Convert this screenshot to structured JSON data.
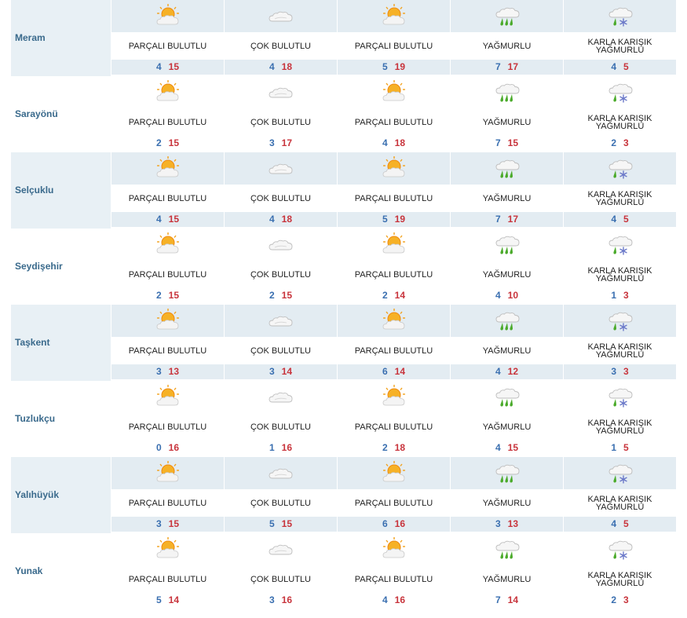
{
  "conditions": {
    "partly_cloudy": "PARÇALI BULUTLU",
    "very_cloudy": "ÇOK BULUTLU",
    "rainy": "YAĞMURLU",
    "sleet": "KARLA KARIŞIK YAĞMURLU"
  },
  "day_conditions": [
    "partly_cloudy",
    "very_cloudy",
    "partly_cloudy",
    "rainy",
    "sleet"
  ],
  "icons": {
    "partly_cloudy": "sun-cloud-icon",
    "very_cloudy": "cloud-icon",
    "rainy": "rain-icon",
    "sleet": "sleet-icon"
  },
  "colors": {
    "low": "#3a6fb0",
    "high": "#c8343c",
    "city": "#3a6a8c",
    "shade": "#e3ecf2"
  },
  "rows": [
    {
      "city": "Meram",
      "temps": [
        [
          4,
          15
        ],
        [
          4,
          18
        ],
        [
          5,
          19
        ],
        [
          7,
          17
        ],
        [
          4,
          5
        ]
      ]
    },
    {
      "city": "Sarayönü",
      "temps": [
        [
          2,
          15
        ],
        [
          3,
          17
        ],
        [
          4,
          18
        ],
        [
          7,
          15
        ],
        [
          2,
          3
        ]
      ]
    },
    {
      "city": "Selçuklu",
      "temps": [
        [
          4,
          15
        ],
        [
          4,
          18
        ],
        [
          5,
          19
        ],
        [
          7,
          17
        ],
        [
          4,
          5
        ]
      ]
    },
    {
      "city": "Seydişehir",
      "temps": [
        [
          2,
          15
        ],
        [
          2,
          15
        ],
        [
          2,
          14
        ],
        [
          4,
          10
        ],
        [
          1,
          3
        ]
      ]
    },
    {
      "city": "Taşkent",
      "temps": [
        [
          3,
          13
        ],
        [
          3,
          14
        ],
        [
          6,
          14
        ],
        [
          4,
          12
        ],
        [
          3,
          3
        ]
      ]
    },
    {
      "city": "Tuzlukçu",
      "temps": [
        [
          0,
          16
        ],
        [
          1,
          16
        ],
        [
          2,
          18
        ],
        [
          4,
          15
        ],
        [
          1,
          5
        ]
      ]
    },
    {
      "city": "Yalıhüyük",
      "temps": [
        [
          3,
          15
        ],
        [
          5,
          15
        ],
        [
          6,
          16
        ],
        [
          3,
          13
        ],
        [
          4,
          5
        ]
      ]
    },
    {
      "city": "Yunak",
      "temps": [
        [
          5,
          14
        ],
        [
          3,
          16
        ],
        [
          4,
          16
        ],
        [
          7,
          14
        ],
        [
          2,
          3
        ]
      ]
    }
  ]
}
